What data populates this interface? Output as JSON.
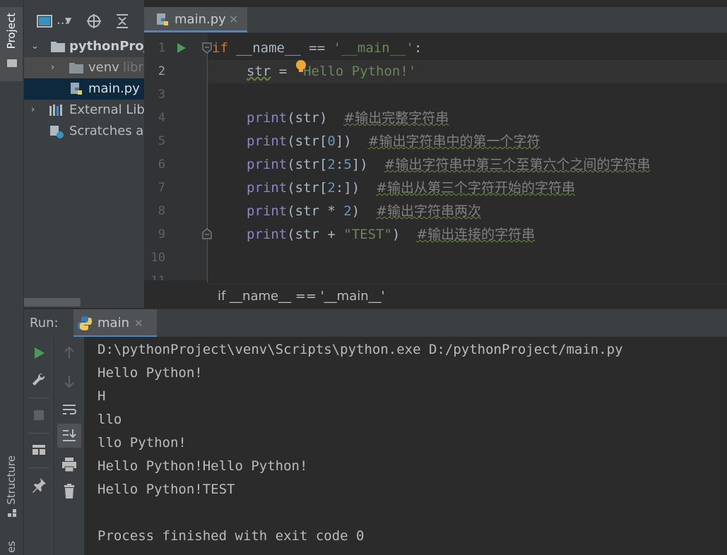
{
  "colors": {
    "background": "#2b2b2b",
    "panel": "#3c3f41",
    "accent": "#4a88c7",
    "keyword": "#cc7832",
    "string": "#6a8759",
    "builtin": "#8888c6",
    "number": "#6897bb",
    "comment": "#808080"
  },
  "sidebar": {
    "project_tab": "Project",
    "structure_tab": "Structure",
    "extra_tab": "es"
  },
  "project_panel": {
    "toolbar": {
      "view_icon": "project-view-icon",
      "dropdown_label": "...",
      "locate_icon": "crosshair-icon",
      "collapse_icon": "collapse-all-icon"
    },
    "tree": [
      {
        "label": "pythonProje",
        "icon": "folder-icon",
        "bold": true
      },
      {
        "label": "venv",
        "suffix": "libr",
        "icon": "folder-icon"
      },
      {
        "label": "main.py",
        "icon": "python-file-icon"
      },
      {
        "label": "External Libr",
        "icon": "library-icon"
      },
      {
        "label": "Scratches ar",
        "icon": "scratches-icon"
      }
    ]
  },
  "editor": {
    "tab_label": "main.py",
    "line_numbers": [
      "1",
      "2",
      "3",
      "4",
      "5",
      "6",
      "7",
      "8",
      "9",
      "10",
      "11"
    ],
    "breadcrumb": "if __name__ == '__main__'",
    "code": {
      "l1_kw": "if",
      "l1_rest": " __name__ == ",
      "l1_str": "'__main__'",
      "l1_colon": ":",
      "l2_var": "str",
      "l2_eq": " = ",
      "l2_str": "'Hello Python!'",
      "print": "print",
      "l4_args": "(str)",
      "l4_cmt": "#输出完整字符串",
      "l5_a": "(str[",
      "l5_n": "0",
      "l5_b": "])",
      "l5_cmt": "#输出字符串中的第一个字符",
      "l6_a": "(str[",
      "l6_n1": "2",
      "l6_c": ":",
      "l6_n2": "5",
      "l6_b": "])",
      "l6_cmt": "#输出字符串中第三个至第六个之间的字符串",
      "l7_a": "(str[",
      "l7_n": "2",
      "l7_b": ":])",
      "l7_cmt": "#输出从第三个字符开始的字符串",
      "l8_a": "(str * ",
      "l8_n": "2",
      "l8_b": ")",
      "l8_cmt": "#输出字符串两次",
      "l9_a": "(str + ",
      "l9_str": "\"TEST\"",
      "l9_b": ")",
      "l9_cmt": "#输出连接的字符串"
    }
  },
  "run_panel": {
    "label": "Run:",
    "tab_label": "main",
    "console": [
      "D:\\pythonProject\\venv\\Scripts\\python.exe D:/pythonProject/main.py",
      "Hello Python!",
      "H",
      "llo",
      "llo Python!",
      "Hello Python!Hello Python!",
      "Hello Python!TEST",
      "",
      "Process finished with exit code 0"
    ]
  }
}
